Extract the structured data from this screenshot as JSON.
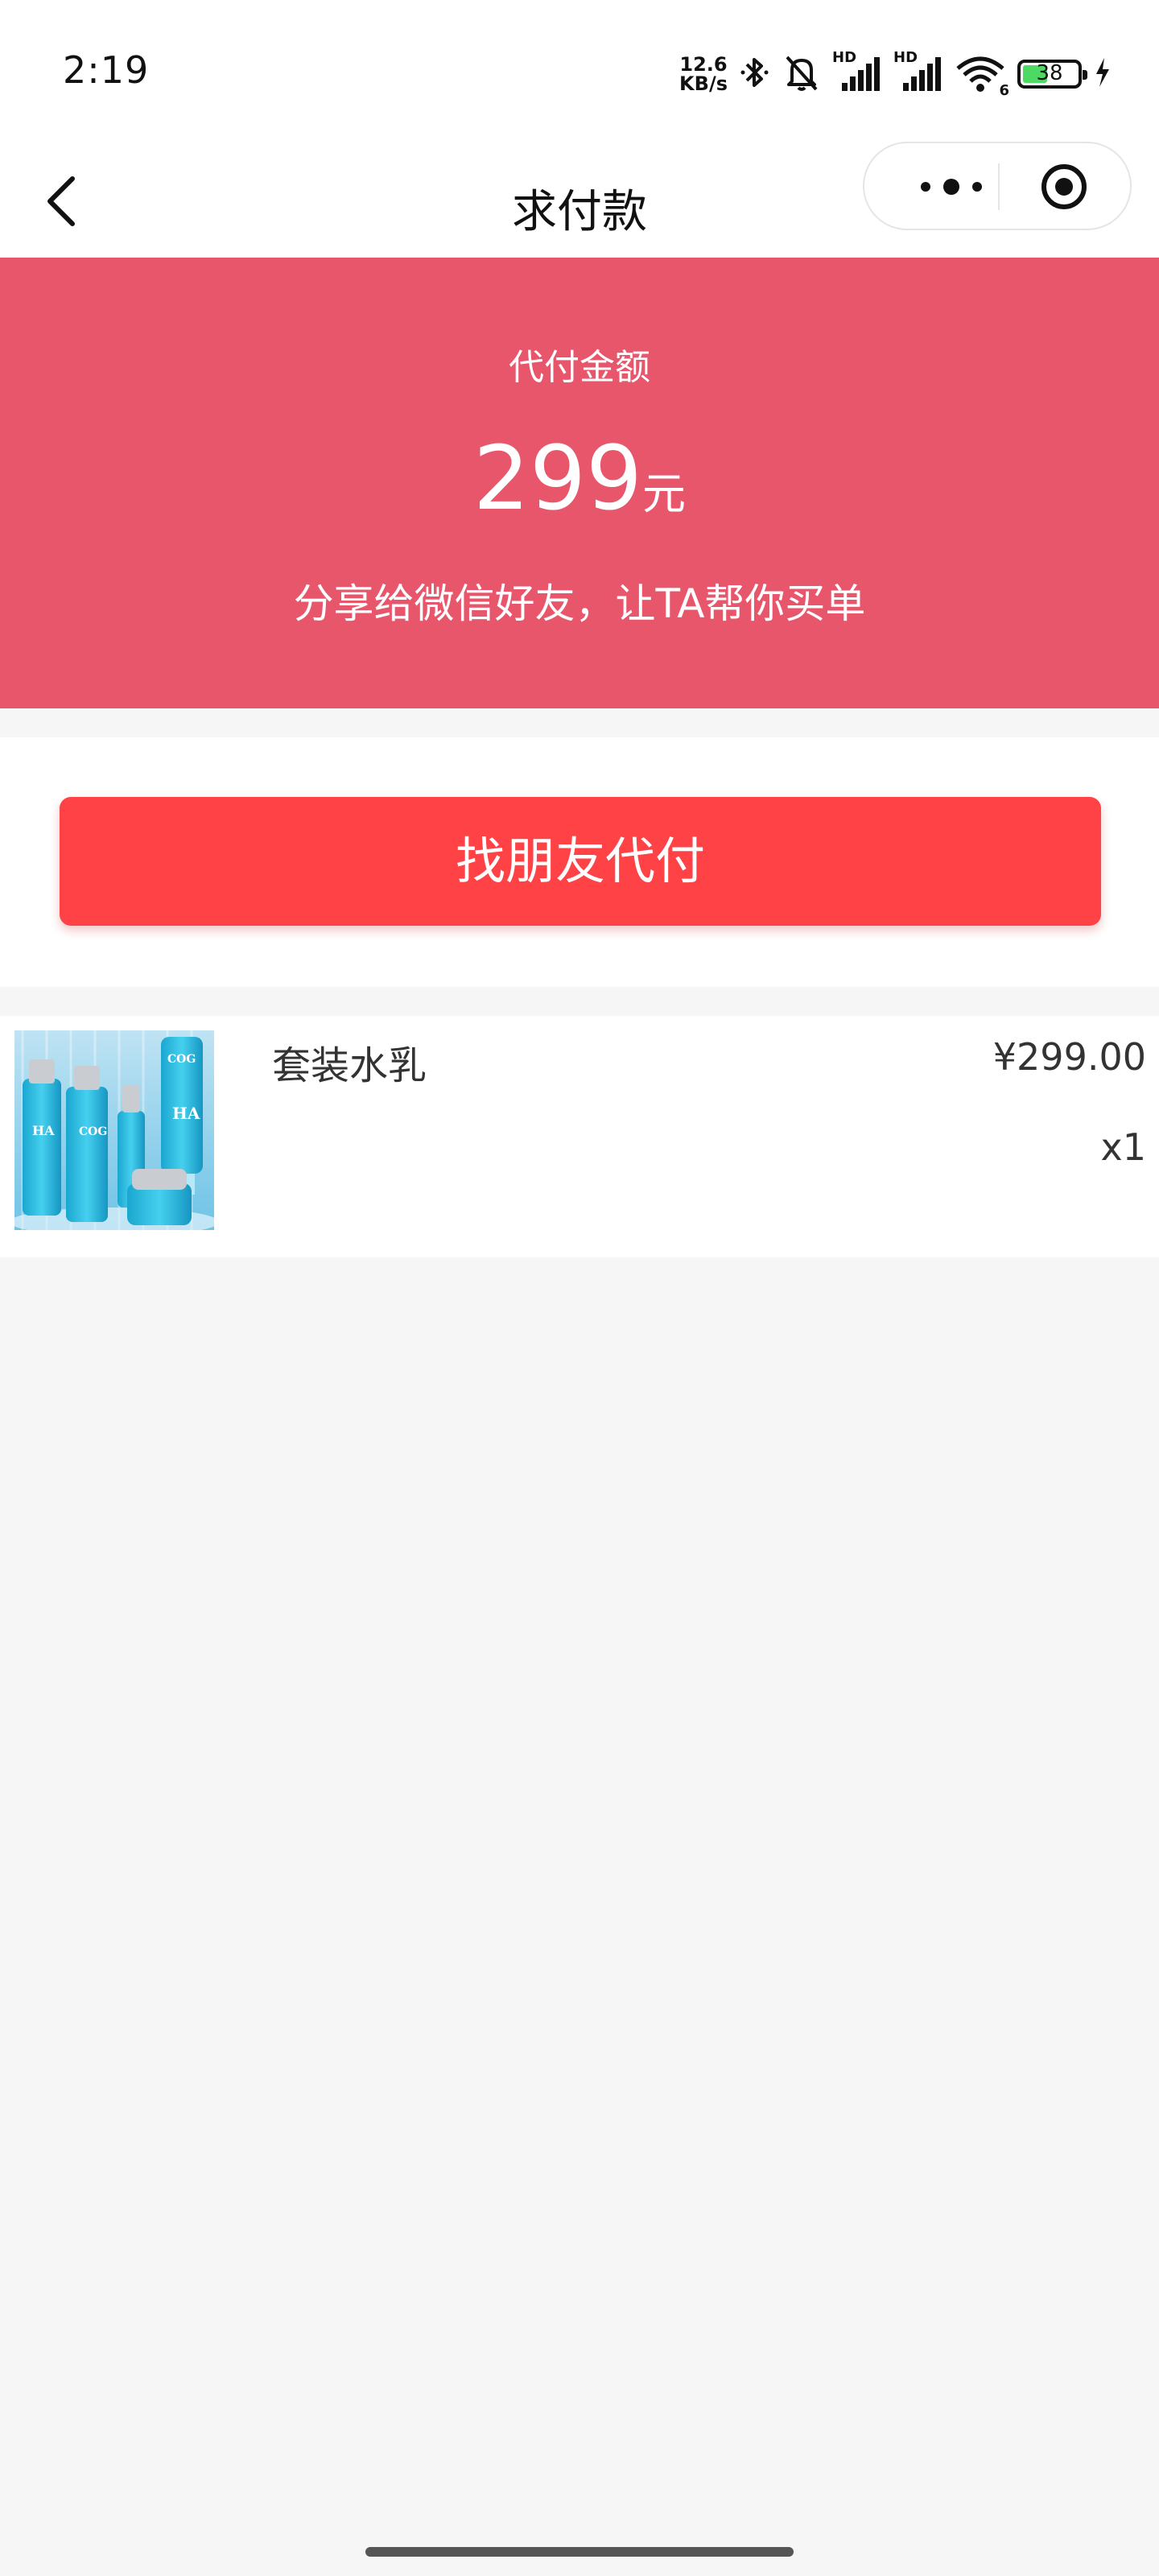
{
  "status_bar": {
    "time": "2:19",
    "net_speed_value": "12.6",
    "net_speed_unit": "KB/s",
    "signal1_label": "HD",
    "signal2_label": "HD",
    "wifi_label": "6",
    "battery_level": "38",
    "icons": [
      "bluetooth-icon",
      "mute-bell-icon",
      "signal-icon",
      "signal-icon",
      "wifi-icon",
      "battery-icon",
      "charging-icon"
    ]
  },
  "nav": {
    "title": "求付款",
    "back_icon": "chevron-left-icon",
    "more_icon": "more-dots-icon",
    "close_icon": "target-circle-icon"
  },
  "amount_panel": {
    "label": "代付金额",
    "amount": "299",
    "unit": "元",
    "description": "分享给微信好友，让TA帮你买单",
    "color": "#e8566c"
  },
  "pay_button": {
    "label": "找朋友代付",
    "color": "#fe4245"
  },
  "product": {
    "name": "套装水乳",
    "price": "¥299.00",
    "quantity": "x1",
    "image_brand_text": "COG"
  }
}
